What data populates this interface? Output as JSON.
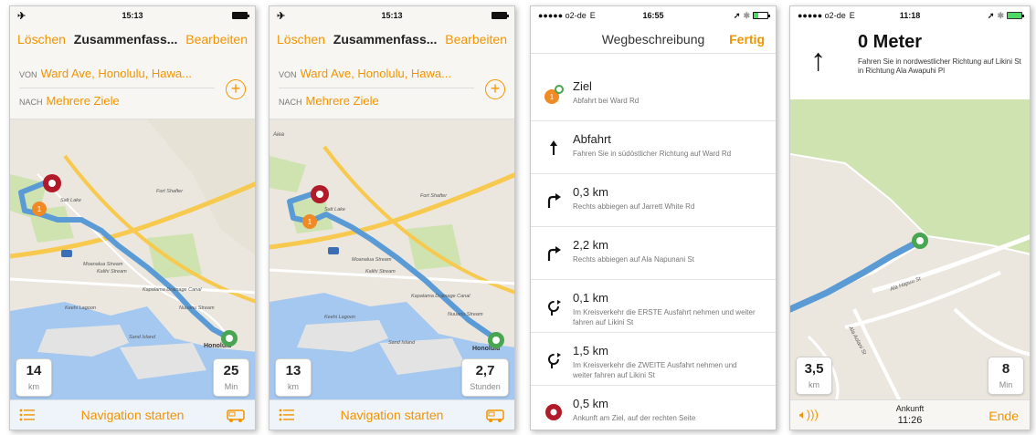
{
  "screen1": {
    "status": {
      "time": "15:13"
    },
    "nav": {
      "left": "Löschen",
      "title": "Zusammenfass...",
      "right": "Bearbeiten"
    },
    "route": {
      "from_label": "VON",
      "from_value": "Ward Ave, Honolulu, Hawa...",
      "to_label": "NACH",
      "to_value": "Mehrere Ziele"
    },
    "map_labels": {
      "l1": "Fort Shafter",
      "l2": "Salt Lake",
      "l3": "Moanalua Stream",
      "l4": "Kalihi Stream",
      "l5": "Keehi Lagoon",
      "l6": "Kapalama Drainage Canal",
      "l7": "Nuuanu Stream",
      "l8": "Honolulu",
      "l9": "Sand Island"
    },
    "marker_number": "1",
    "distance": {
      "value": "14",
      "unit": "km"
    },
    "duration": {
      "value": "25",
      "unit": "Min"
    },
    "bottom": {
      "start": "Navigation starten"
    }
  },
  "screen2": {
    "status": {
      "time": "15:13"
    },
    "nav": {
      "left": "Löschen",
      "title": "Zusammenfass...",
      "right": "Bearbeiten"
    },
    "route": {
      "from_label": "VON",
      "from_value": "Ward Ave, Honolulu, Hawa...",
      "to_label": "NACH",
      "to_value": "Mehrere Ziele"
    },
    "map_labels": {
      "l0": "Aiea",
      "l1": "Fort Shafter",
      "l2": "Salt Lake",
      "l3": "Moanalua Stream",
      "l4": "Kalihi Stream",
      "l5": "Keehi Lagoon",
      "l6": "Kapalama Drainage Canal",
      "l7": "Nuuanu Stream",
      "l8": "Honolulu",
      "l9": "Sand Island"
    },
    "marker_number": "1",
    "distance": {
      "value": "13",
      "unit": "km"
    },
    "duration": {
      "value": "2,7",
      "unit": "Stunden"
    },
    "bottom": {
      "start": "Navigation starten"
    }
  },
  "screen3": {
    "status": {
      "carrier": "●●●●● o2-de",
      "network": "E",
      "time": "16:55"
    },
    "nav": {
      "title": "Wegbeschreibung",
      "done": "Fertig"
    },
    "marker_number": "1",
    "directions": [
      {
        "main": "Ziel",
        "sub": "Abfahrt bei Ward Rd",
        "icon": "start-marker-icon"
      },
      {
        "main": "Abfahrt",
        "sub": "Fahren Sie in südöstlicher Richtung auf Ward Rd",
        "icon": "arrow-up-icon"
      },
      {
        "main": "0,3 km",
        "sub": "Rechts abbiegen auf Jarrett White Rd",
        "icon": "turn-right-icon"
      },
      {
        "main": "2,2 km",
        "sub": "Rechts abbiegen auf Ala Napunani St",
        "icon": "turn-right-icon"
      },
      {
        "main": "0,1 km",
        "sub": "Im Kreisverkehr die ERSTE Ausfahrt nehmen und weiter fahren  auf Likini St",
        "icon": "roundabout-icon"
      },
      {
        "main": "1,5 km",
        "sub": "Im Kreisverkehr die ZWEITE Ausfahrt nehmen und weiter fahren  auf Likini St",
        "icon": "roundabout-icon"
      },
      {
        "main": "0,5 km",
        "sub": "Ankunft am Ziel, auf der rechten Seite",
        "icon": "destination-icon"
      }
    ]
  },
  "screen4": {
    "status": {
      "carrier": "●●●●● o2-de",
      "network": "E",
      "time": "11:18"
    },
    "guidance": {
      "distance": "0 Meter",
      "text": "Fahren Sie in nordwestlicher Richtung auf Likini St in Richtung Ala Awapuhi Pl"
    },
    "map_labels": {
      "l1": "Ala Hapuu St",
      "l2": "Ala Aolani St"
    },
    "distance": {
      "value": "3,5",
      "unit": "km"
    },
    "duration": {
      "value": "8",
      "unit": "Min"
    },
    "bottom": {
      "arrival_label": "Ankunft",
      "arrival_time": "11:26",
      "end": "Ende"
    }
  },
  "colors": {
    "accent": "#f29400",
    "route": "#5b9bd5",
    "water": "#a5c8f0",
    "land": "#ebe7df",
    "park": "#cfe3b0",
    "highway": "#f7c94e"
  }
}
